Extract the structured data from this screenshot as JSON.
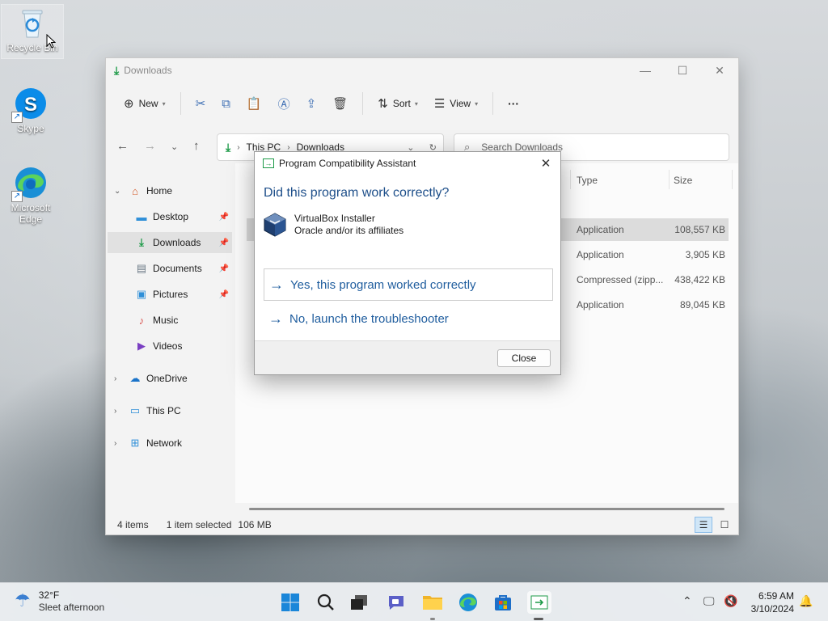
{
  "desktop": {
    "icons": [
      {
        "label": "Recycle Bin",
        "icon": "recycle-bin-icon"
      },
      {
        "label": "Skype",
        "icon": "skype-icon"
      },
      {
        "label": "Microsoft Edge",
        "icon": "edge-icon"
      }
    ]
  },
  "explorer": {
    "title": "Downloads",
    "toolbar": {
      "new_label": "New",
      "sort_label": "Sort",
      "view_label": "View",
      "more_label": "···"
    },
    "address": {
      "root": "This PC",
      "current": "Downloads"
    },
    "search": {
      "placeholder": "Search Downloads"
    },
    "nav": {
      "home": "Home",
      "desktop": "Desktop",
      "downloads": "Downloads",
      "documents": "Documents",
      "pictures": "Pictures",
      "music": "Music",
      "videos": "Videos",
      "onedrive": "OneDrive",
      "thispc": "This PC",
      "network": "Network"
    },
    "columns": {
      "type": "Type",
      "size": "Size"
    },
    "files": [
      {
        "type": "Application",
        "size": "108,557 KB",
        "selected": true
      },
      {
        "type": "Application",
        "size": "3,905 KB",
        "selected": false
      },
      {
        "type": "Compressed (zipp...",
        "size": "438,422 KB",
        "selected": false
      },
      {
        "type": "Application",
        "size": "89,045 KB",
        "selected": false
      }
    ],
    "status": {
      "items": "4 items",
      "selected": "1 item selected",
      "size": "106 MB"
    }
  },
  "dialog": {
    "title": "Program Compatibility Assistant",
    "heading": "Did this program work correctly?",
    "app_name": "VirtualBox Installer",
    "publisher": "Oracle and/or its affiliates",
    "option_yes": "Yes, this program worked correctly",
    "option_no": "No, launch the troubleshooter",
    "close_label": "Close"
  },
  "taskbar": {
    "weather_temp": "32°F",
    "weather_desc": "Sleet afternoon",
    "time": "6:59 AM",
    "date": "3/10/2024"
  },
  "colors": {
    "accent": "#1f5d9e",
    "download_green": "#1d9a48",
    "selection": "#dcdcdc"
  }
}
